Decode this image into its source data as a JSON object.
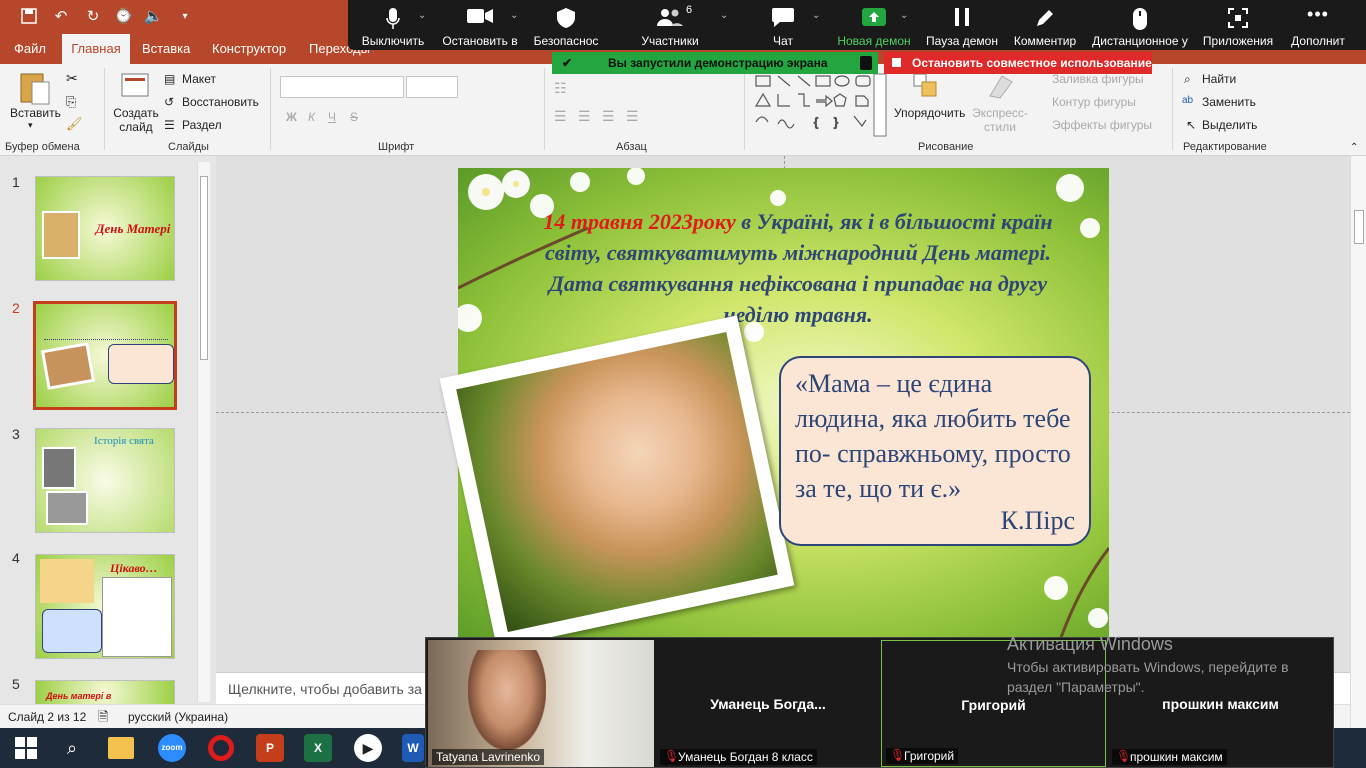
{
  "titlebar": {
    "autosave_hint": ""
  },
  "ribbon_tabs": [
    "Файл",
    "Главная",
    "Вставка",
    "Конструктор",
    "Переходы"
  ],
  "ribbon": {
    "paste": "Вставить",
    "new_slide": "Создать слайд",
    "layout": "Макет",
    "reset": "Восстановить",
    "section": "Раздел",
    "groups": {
      "clipboard": "Буфер обмена",
      "slides": "Слайды",
      "font": "Шрифт",
      "paragraph": "Абзац",
      "drawing": "Рисование",
      "editing": "Редактирование"
    },
    "font_bold": "Ж",
    "font_italic": "К",
    "font_underline": "Ч",
    "font_strike": "S",
    "arrange": "Упорядочить",
    "quick_styles": "Экспресс-стили",
    "shape_fill": "Заливка фигуры",
    "shape_outline": "Контур фигуры",
    "shape_effects": "Эффекты фигуры",
    "find": "Найти",
    "replace": "Заменить",
    "select": "Выделить"
  },
  "zoom": {
    "buttons": [
      {
        "label": "Выключить",
        "icon": "microphone-icon"
      },
      {
        "label": "Остановить в",
        "icon": "video-camera-icon"
      },
      {
        "label": "Безопаснос",
        "icon": "shield-icon"
      },
      {
        "label": "Участники",
        "icon": "participants-icon",
        "count": "6"
      },
      {
        "label": "Чат",
        "icon": "chat-icon"
      },
      {
        "label": "Новая демон",
        "icon": "share-screen-icon"
      },
      {
        "label": "Пауза демон",
        "icon": "pause-icon"
      },
      {
        "label": "Комментир",
        "icon": "pen-icon"
      },
      {
        "label": "Дистанционное у",
        "icon": "mouse-icon"
      },
      {
        "label": "Приложения",
        "icon": "apps-icon"
      },
      {
        "label": "Дополнит",
        "icon": "more-icon"
      }
    ],
    "share_banner": "Вы запустили демонстрацию экрана",
    "stop_share": "Остановить совместное использование"
  },
  "slides": [
    {
      "num": "1",
      "title": "День Матері"
    },
    {
      "num": "2",
      "title": ""
    },
    {
      "num": "3",
      "title": "Історія свята"
    },
    {
      "num": "4",
      "title": "Цікаво…"
    },
    {
      "num": "5",
      "title": "День матері в"
    }
  ],
  "slide": {
    "date_red": "14 травня 2023року",
    "intro": " в Україні, як і в більшості країн світу, святкуватимуть міжнародний День матері. Дата святкування нефіксована і припадає на другу неділю травня.",
    "quote": "«Мама – це єдина людина, яка любить тебе по- справжньому, просто за те, що ти є.»",
    "author": "К.Пірс"
  },
  "notes_placeholder": "Щелкните, чтобы добавить за",
  "status": {
    "slide_count": "Слайд 2 из 12",
    "language": "русский (Украина)"
  },
  "video": {
    "tiles": [
      {
        "name": "Tatyana Lavrinenko",
        "center": ""
      },
      {
        "name": "Уманець Богдан 8 класс",
        "center": "Уманець  Богда..."
      },
      {
        "name": "Григорий",
        "center": "Григорий"
      },
      {
        "name": "прошкин максим",
        "center": "прошкин максим"
      }
    ]
  },
  "activation": {
    "title": "Активация Windows",
    "text": "Чтобы активировать Windows, перейдите в раздел \"Параметры\"."
  },
  "colors": {
    "accent": "#b7472a",
    "zoom_bg": "#1a1a1a",
    "share_green": "#23a540",
    "stop_red": "#e02a2a",
    "slide_blue": "#2e4677",
    "slide_red": "#e01b1b"
  }
}
